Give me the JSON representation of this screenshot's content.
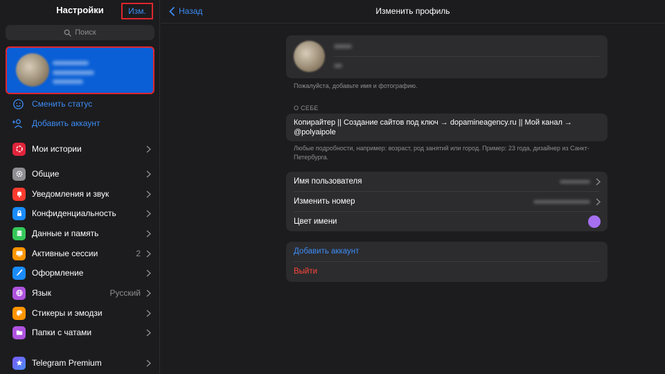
{
  "sidebar": {
    "title": "Настройки",
    "edit_label": "Изм.",
    "search_placeholder": "Поиск",
    "actions": [
      {
        "label": "Сменить статус",
        "icon": "smiley-status-icon"
      },
      {
        "label": "Добавить аккаунт",
        "icon": "add-person-icon"
      }
    ],
    "items": [
      {
        "label": "Мои истории",
        "icon": "stories-icon",
        "color": "#e0253b",
        "value": ""
      },
      {
        "label": "Общие",
        "icon": "gear-icon",
        "color": "#8e8e93",
        "value": ""
      },
      {
        "label": "Уведомления и звук",
        "icon": "bell-icon",
        "color": "#ff3b30",
        "value": ""
      },
      {
        "label": "Конфиденциальность",
        "icon": "lock-icon",
        "color": "#1a8cff",
        "value": ""
      },
      {
        "label": "Данные и память",
        "icon": "database-icon",
        "color": "#34c759",
        "value": ""
      },
      {
        "label": "Активные сессии",
        "icon": "devices-icon",
        "color": "#ff9500",
        "value": "2"
      },
      {
        "label": "Оформление",
        "icon": "brush-icon",
        "color": "#1a8cff",
        "value": ""
      },
      {
        "label": "Язык",
        "icon": "globe-icon",
        "color": "#af52de",
        "value": "Русский"
      },
      {
        "label": "Стикеры и эмодзи",
        "icon": "sticker-icon",
        "color": "#ff9500",
        "value": ""
      },
      {
        "label": "Папки с чатами",
        "icon": "folder-icon",
        "color": "#af52de",
        "value": ""
      },
      {
        "label": "Telegram Premium",
        "icon": "star-icon",
        "color": "#7a5af8",
        "value": ""
      }
    ]
  },
  "main": {
    "back_label": "Назад",
    "title": "Изменить профиль",
    "name_hint": "Пожалуйста, добавьте имя и фотографию.",
    "about_section_label": "О СЕБЕ",
    "bio_text": "Копирайтер || Создание сайтов под ключ → dopamineagency.ru || Мой канал → @polyaipole",
    "bio_hint": "Любые подробности, например: возраст, род занятий или город. Пример: 23 года, дизайнер из Санкт-Петербурга.",
    "rows": [
      {
        "label": "Имя пользователя"
      },
      {
        "label": "Изменить номер"
      },
      {
        "label": "Цвет имени",
        "color": "#a56ff0"
      }
    ],
    "add_account_label": "Добавить аккаунт",
    "logout_label": "Выйти",
    "accent_color": "#3d8cf5",
    "danger_color": "#ff453a"
  }
}
